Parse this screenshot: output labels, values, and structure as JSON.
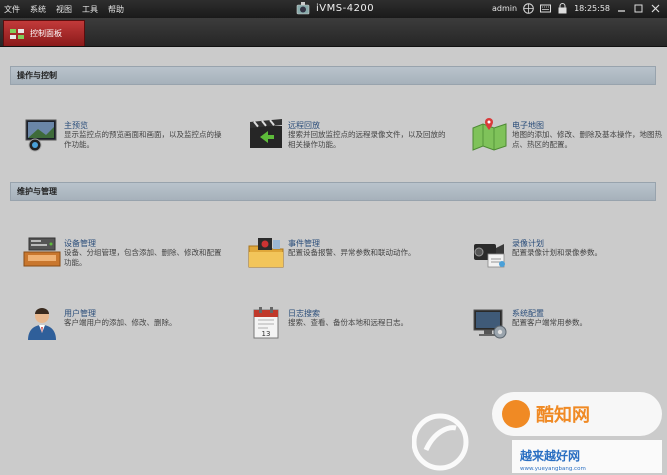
{
  "menu": {
    "items": [
      "文件",
      "系统",
      "视图",
      "工具",
      "帮助"
    ]
  },
  "app": {
    "title": "iVMS-4200"
  },
  "status": {
    "user": "admin",
    "time": "18:25:58"
  },
  "tab": {
    "label": "控制面板"
  },
  "sections": [
    {
      "title": "操作与控制",
      "items": [
        {
          "title": "主预览",
          "desc": "显示监控点的预览画面和画面，以及监控点的操作功能。",
          "icon": "monitor-icon"
        },
        {
          "title": "远程回放",
          "desc": "搜索并回放监控点的远程录像文件，以及回放的相关操作功能。",
          "icon": "clapperboard-icon"
        },
        {
          "title": "电子地图",
          "desc": "地图的添加、修改、删除及基本操作，地图热点、热区的配置。",
          "icon": "map-icon"
        }
      ]
    },
    {
      "title": "维护与管理",
      "items": [
        {
          "title": "设备管理",
          "desc": "设备、分组管理，包含添加、删除、修改和配置功能。",
          "icon": "device-icon"
        },
        {
          "title": "事件管理",
          "desc": "配置设备报警、异常参数和联动动作。",
          "icon": "event-folder-icon"
        },
        {
          "title": "录像计划",
          "desc": "配置录像计划和录像参数。",
          "icon": "camera-icon"
        },
        {
          "title": "用户管理",
          "desc": "客户端用户的添加、修改、删除。",
          "icon": "user-icon"
        },
        {
          "title": "日志搜索",
          "desc": "搜索、查看、备份本地和远程日志。",
          "icon": "calendar-icon"
        },
        {
          "title": "系统配置",
          "desc": "配置客户端常用参数。",
          "icon": "system-config-icon"
        }
      ]
    }
  ],
  "colors": {
    "accent": "#b32a2a",
    "link": "#2a4d7a"
  }
}
